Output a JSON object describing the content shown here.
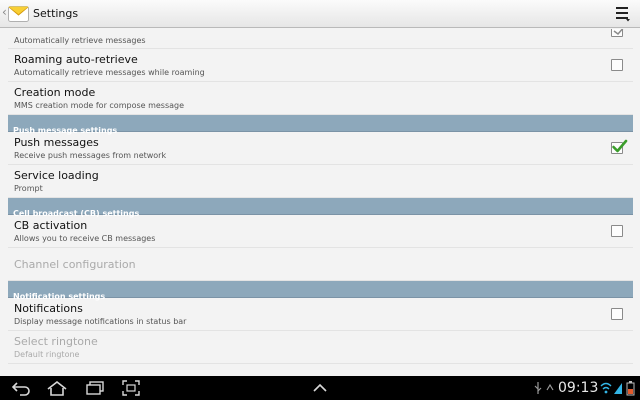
{
  "action_bar": {
    "title": "Settings",
    "back_icon": "chevron-left-icon",
    "app_icon": "envelope-icon",
    "menu_icon": "overflow-menu-icon"
  },
  "settings": {
    "partial_row": {
      "summary": "Automatically retrieve messages",
      "checked": true
    },
    "roaming_auto_retrieve": {
      "title": "Roaming auto-retrieve",
      "summary": "Automatically retrieve messages while roaming",
      "checked": false
    },
    "creation_mode": {
      "title": "Creation mode",
      "summary": "MMS creation mode for compose message"
    },
    "push_header": "Push message settings",
    "push_messages": {
      "title": "Push messages",
      "summary": "Receive push messages from network",
      "checked": true
    },
    "service_loading": {
      "title": "Service loading",
      "summary": "Prompt"
    },
    "cb_header": "Cell broadcast (CB) settings",
    "cb_activation": {
      "title": "CB activation",
      "summary": "Allows you to receive CB messages",
      "checked": false
    },
    "channel_configuration": {
      "title": "Channel configuration",
      "enabled": false
    },
    "notification_header": "Notification settings",
    "notifications": {
      "title": "Notifications",
      "summary": "Display message notifications in status bar",
      "checked": false
    },
    "select_ringtone": {
      "title": "Select ringtone",
      "summary": "Default ringtone",
      "enabled": false
    }
  },
  "nav_bar": {
    "clock": "09:13",
    "buttons": [
      "back-icon",
      "home-icon",
      "recent-apps-icon",
      "screenshot-icon",
      "expand-up-icon"
    ],
    "status_icons": [
      "usb-icon",
      "sync-icon",
      "wifi-icon",
      "signal-icon",
      "battery-icon"
    ],
    "accent_color": "#33b5e5"
  },
  "colors": {
    "section_header": "#8da8bb",
    "list_background": "#f3f3f3",
    "check_green": "#3a9d2a"
  }
}
